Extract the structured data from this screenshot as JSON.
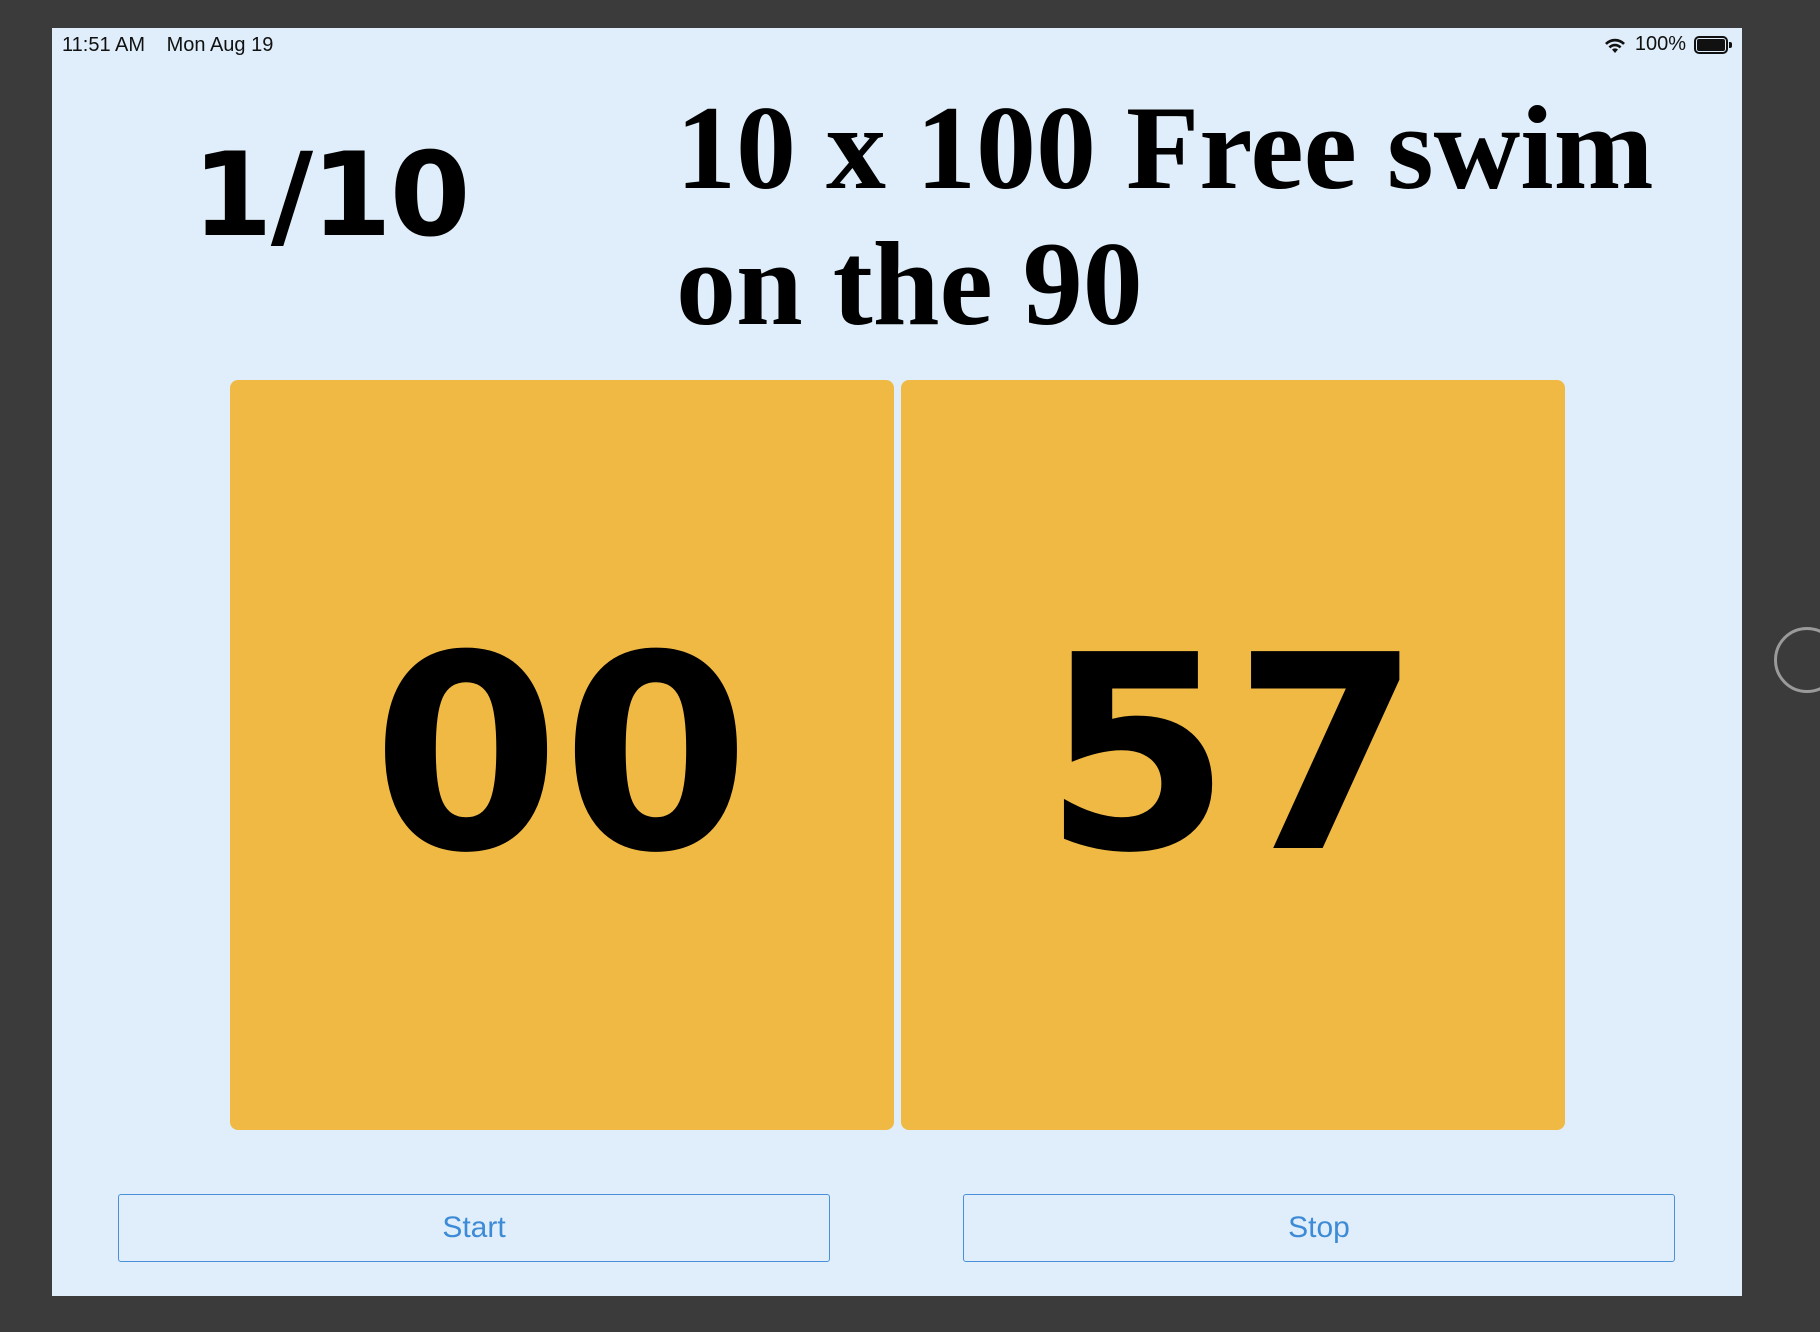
{
  "status_bar": {
    "time": "11:51 AM",
    "date": "Mon Aug 19",
    "battery_text": "100%",
    "wifi_icon": "wifi-icon",
    "battery_icon": "battery-icon",
    "battery_level": 1.0
  },
  "header": {
    "rep_counter": "1/10",
    "workout_title": "10 x 100 Free swim on the 90"
  },
  "timer": {
    "minutes": "00",
    "seconds": "57",
    "panel_color": "#f0b944"
  },
  "buttons": {
    "start_label": "Start",
    "stop_label": "Stop",
    "accent_color": "#3d8bd6"
  },
  "colors": {
    "background": "#dfeefa",
    "frame": "#3b3b3b"
  }
}
